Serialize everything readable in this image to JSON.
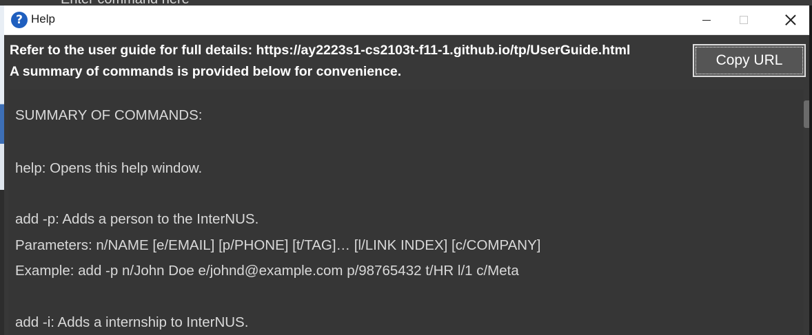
{
  "background_app": {
    "command_placeholder": "Enter command here"
  },
  "window": {
    "title": "Help",
    "icon": "help-question-icon",
    "controls": [
      "minimize-icon",
      "maximize-icon",
      "close-icon"
    ]
  },
  "header": {
    "guide_line": "Refer to the user guide for full details: https://ay2223s1-cs2103t-f11-1.github.io/tp/UserGuide.html",
    "summary_line": "A summary of commands is provided below for convenience.",
    "copy_button_label": "Copy URL"
  },
  "content": {
    "lines": [
      "SUMMARY OF COMMANDS:",
      "help: Opens this help window.",
      "add -p: Adds a person to the InterNUS.",
      "Parameters: n/NAME [e/EMAIL] [p/PHONE] [t/TAG]… [l/LINK INDEX] [c/COMPANY]",
      "Example: add -p n/John Doe e/johnd@example.com p/98765432 t/HR l/1 c/Meta",
      "add -i: Adds a internship to InterNUS."
    ]
  },
  "colors": {
    "window_bg": "#383838",
    "titlebar_bg": "#ffffff",
    "button_bg": "#555555",
    "text": "#d9d9d9"
  }
}
